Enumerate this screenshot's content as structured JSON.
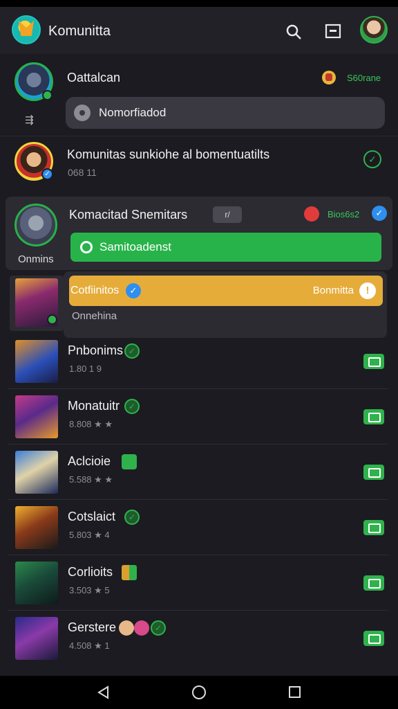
{
  "app": {
    "title": "Komunitta"
  },
  "post1": {
    "name": "Oattalcan",
    "coin_text": "S60rane",
    "reply_text": "Nomorfiadod"
  },
  "post2": {
    "title": "Komunitas sunkiohe al bomentuatilts",
    "meta": "068 11"
  },
  "highlight": {
    "name": "Komacitad Snemitars",
    "tag": "r/",
    "coin_text": "Bios6s2",
    "bar_text": "Samitoadenst",
    "status": "Onmins"
  },
  "notice": {
    "title": "Cotfiinitos",
    "right_text": "Bonmitta",
    "status": "Onnehina"
  },
  "rows": [
    {
      "title": "Pnbonims",
      "sub": "1.80 1 9"
    },
    {
      "title": "Monatuitr",
      "sub": "8.808 ★ ★"
    },
    {
      "title": "Aclcioie",
      "sub": "5.588 ★ ★"
    },
    {
      "title": "Cotslaict",
      "sub": "5.803 ★ 4"
    },
    {
      "title": "Corlioits",
      "sub": "3.503 ★ 5"
    },
    {
      "title": "Gerstere",
      "sub": "4.508 ★ 1"
    }
  ],
  "icons": [
    "search-icon",
    "message-icon",
    "settings-icon",
    "check-icon",
    "video-icon",
    "back-icon",
    "home-icon",
    "recents-icon"
  ],
  "colors": {
    "accent_green": "#2fb24c",
    "accent_yellow": "#e6ac3a",
    "accent_blue": "#2f8ff0",
    "background": "#1c1b21"
  }
}
